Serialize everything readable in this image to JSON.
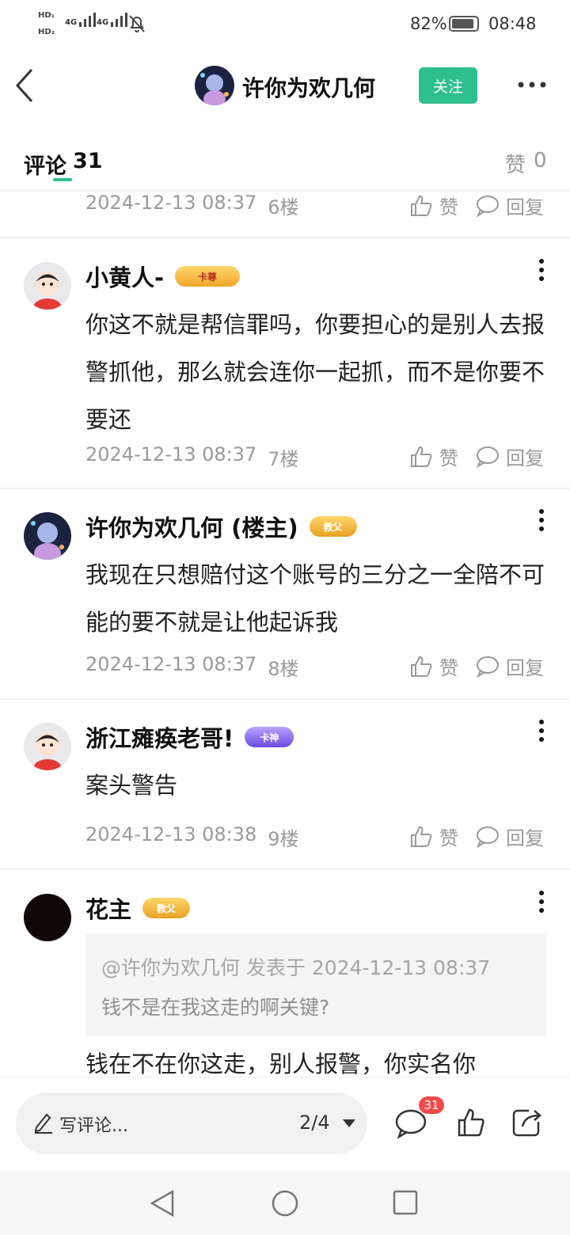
{
  "status_bar": {
    "battery_percent": "82%",
    "time": "08:48",
    "signal_1": "4G",
    "signal_2": "4G"
  },
  "header": {
    "title": "许你为欢几何",
    "follow_label": "关注",
    "back_icon": "chevron-left-icon",
    "more_icon": "more-horizontal-icon"
  },
  "tabs": {
    "comments_label": "评论",
    "comments_count": "31",
    "likes_label": "赞",
    "likes_count": "0"
  },
  "action_labels": {
    "like": "赞",
    "reply": "回复"
  },
  "comments": [
    {
      "timestamp": "2024-12-13 08:37",
      "floor": "6楼"
    },
    {
      "username": "小黄人-",
      "badge": "卡尊",
      "text": "你这不就是帮信罪吗，你要担心的是别人去报警抓他，那么就会连你一起抓，而不是你要不要还",
      "timestamp": "2024-12-13 08:37",
      "floor": "7楼"
    },
    {
      "username": "许你为欢几何 (楼主)",
      "badge": "教父",
      "text": "我现在只想赔付这个账号的三分之一全陪不可能的要不就是让他起诉我",
      "timestamp": "2024-12-13 08:37",
      "floor": "8楼"
    },
    {
      "username": "浙江瘫痪老哥!",
      "badge": "卡神",
      "text": "案头警告",
      "timestamp": "2024-12-13 08:38",
      "floor": "9楼"
    },
    {
      "username": "花主",
      "badge": "教父",
      "quote_header": "@许你为欢几何 发表于 2024-12-13 08:37",
      "quote_text": "钱不是在我这走的啊关键?",
      "text": "钱在不在你这走，别人报警，你实名你"
    }
  ],
  "bottom_bar": {
    "write_placeholder": "写评论...",
    "page_indicator": "2/4",
    "comment_badge": "31"
  },
  "colors": {
    "accent": "#2dc08d",
    "badge_red": "#f04b4b",
    "text_gray": "#9a9a9a"
  }
}
